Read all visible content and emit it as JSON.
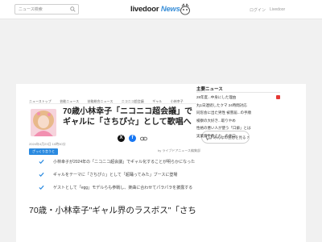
{
  "header": {
    "search_placeholder": "ニュース検索",
    "logo_main": "livedoor",
    "logo_news": "News",
    "login": "ログイン",
    "register": "Livedoor"
  },
  "breadcrumb": [
    "ニューストップ",
    "芸能ニュース",
    "芸能総合ニュース",
    "ニコニコ超会議",
    "ギャル",
    "小林幸子"
  ],
  "article": {
    "title": "70歳小林幸子「ニコニコ超会議」でギャルに「さちぴ☆」として歌唱へ",
    "comment_label": "みんなの感想を見る",
    "comment_count": "7",
    "date": "2024年4月23日 10時30分",
    "source": "by ライブドアニュース編集部",
    "tag": "ざっくり言うと",
    "summary": [
      "小林幸子が2024年の「ニコニコ超会議」でギャル化することが明らかになった",
      "ギャルをテーマに「さちぴ☆」として「超踊ってみた」ブースに登場",
      "ゲストとして「egg」モデルらも参戦し、楽曲に合わせてパラパラを披露する"
    ],
    "lead": "70歳・小林幸子\"ギャル界のラスボス\"「さち"
  },
  "ranking": {
    "title": "主要ニュース",
    "items": [
      "28年度...中身にした理由",
      "丸1日連続したクマ 24時間対応",
      "同窓会に出た男性 被害届...の手順",
      "検察の大好き...取りやめ",
      "性格の悪い人が使う「口癖」とは",
      "実業家を教えた...の手口"
    ]
  },
  "colors": {
    "accent": "#2a8ae0",
    "logo_news": "#3a8fd8",
    "rank_badge": "#e53935",
    "facebook": "#1877f2"
  },
  "icons": [
    "search-icon",
    "mascot-icon",
    "comment-icon",
    "x-share-icon",
    "facebook-share-icon",
    "link-share-icon",
    "check-icon"
  ]
}
